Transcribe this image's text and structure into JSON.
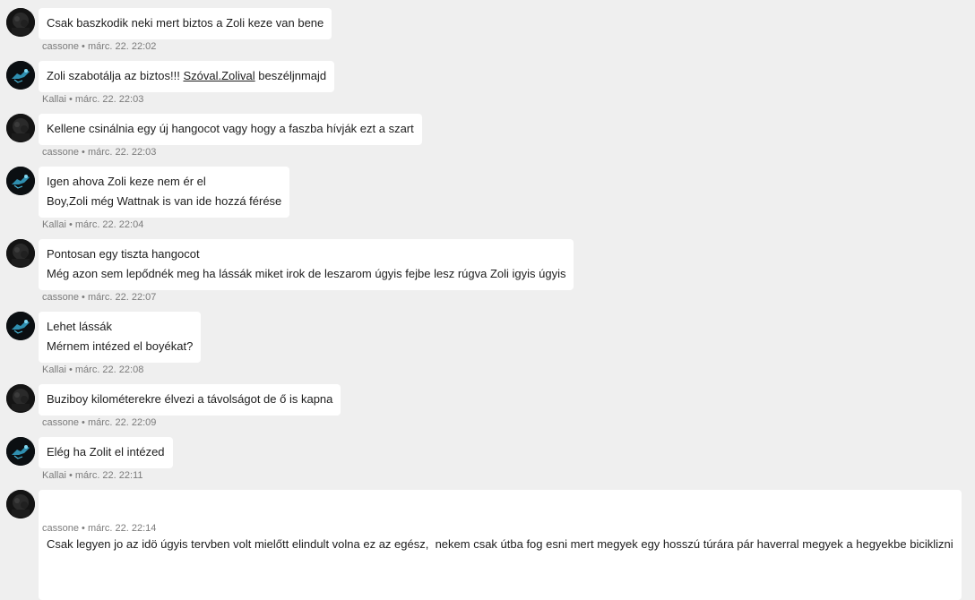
{
  "messages": [
    {
      "author": "cassone",
      "separator": " • ",
      "timestamp": "márc. 22. 22:02",
      "avatar": "dark-avatar-cassone",
      "lines": [
        "Csak baszkodik neki mert biztos a Zoli keze van bene"
      ]
    },
    {
      "author": "Kallai",
      "separator": " • ",
      "timestamp": "márc. 22. 22:03",
      "avatar": "glowing-creature-avatar-kallai",
      "line_parts": {
        "before": "Zoli szabotálja az biztos!!! ",
        "link": "Szóval.Zolival",
        "after": " beszéljnmajd"
      }
    },
    {
      "author": "cassone",
      "separator": " • ",
      "timestamp": "márc. 22. 22:03",
      "avatar": "dark-avatar-cassone",
      "lines": [
        "Kellene csinálnia egy új hangocot vagy hogy a faszba hívják ezt a szart"
      ]
    },
    {
      "author": "Kallai",
      "separator": " • ",
      "timestamp": "márc. 22. 22:04",
      "avatar": "glowing-creature-avatar-kallai",
      "lines": [
        "Igen ahova Zoli keze nem ér el",
        "Boy,Zoli még Wattnak is van ide hozzá férése"
      ]
    },
    {
      "author": "cassone",
      "separator": " • ",
      "timestamp": "márc. 22. 22:07",
      "avatar": "dark-avatar-cassone",
      "lines": [
        "Pontosan egy tiszta hangocot",
        "Még azon sem lepődnék meg ha lássák miket irok de leszarom úgyis fejbe lesz rúgva Zoli igyis úgyis"
      ]
    },
    {
      "author": "Kallai",
      "separator": " • ",
      "timestamp": "márc. 22. 22:08",
      "avatar": "glowing-creature-avatar-kallai",
      "lines": [
        "Lehet lássák",
        "Mérnem intézed el boyékat?"
      ]
    },
    {
      "author": "cassone",
      "separator": " • ",
      "timestamp": "márc. 22. 22:09",
      "avatar": "dark-avatar-cassone",
      "lines": [
        "Buziboy kilométerekre élvezi a távolságot de ő is kapna"
      ]
    },
    {
      "author": "Kallai",
      "separator": " • ",
      "timestamp": "márc. 22. 22:11",
      "avatar": "glowing-creature-avatar-kallai",
      "lines": [
        "Elég ha Zolit el intézed"
      ]
    },
    {
      "author": "cassone",
      "separator": " • ",
      "timestamp": "márc. 22. 22:14",
      "avatar": "dark-avatar-cassone",
      "lines": [
        "Csak legyen jo az idö úgyis tervben volt mielőtt elindult volna ez az egész,  nekem csak útba fog esni mert megyek egy hosszú túrára pár haverral megyek a hegyekbe biciklizni"
      ]
    }
  ],
  "colors": {
    "page_background": "#efefef",
    "bubble_background": "#ffffff",
    "message_text": "#1d1d1d",
    "meta_text": "#7b7b7b"
  }
}
